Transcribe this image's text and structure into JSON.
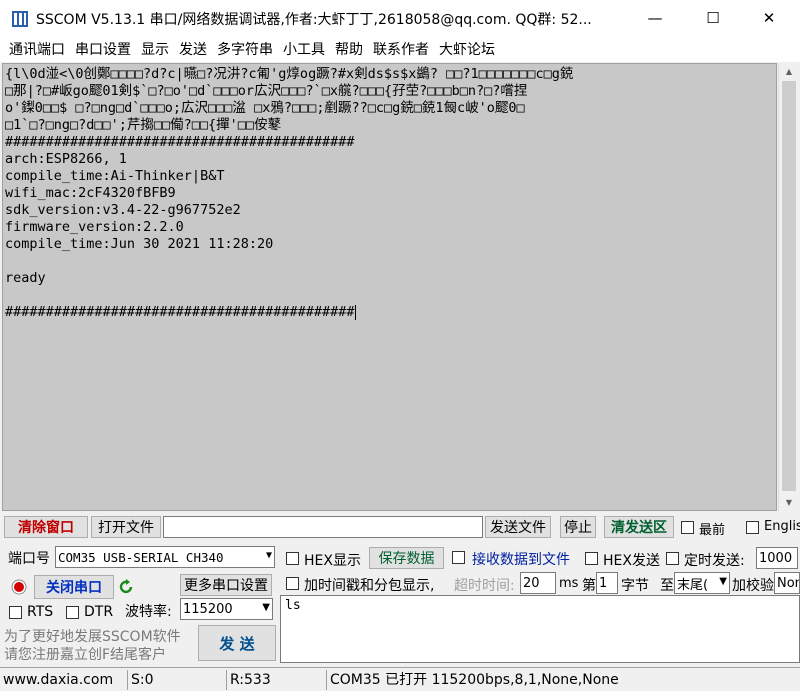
{
  "window": {
    "title": "SSCOM V5.13.1 串口/网络数据调试器,作者:大虾丁丁,2618058@qq.com. QQ群: 52...",
    "minimize": "—",
    "maximize": "☐",
    "close": "✕"
  },
  "menu": [
    "通讯端口",
    "串口设置",
    "显示",
    "发送",
    "多字符串",
    "小工具",
    "帮助",
    "联系作者",
    "大虾论坛"
  ],
  "terminal": {
    "lines": [
      "{l\\0d湴<\\0创鄭□□□□?d?c|曣□?况汫?c匍'g焞og蹶?#x剣ds$s$x鷁? □□?1□□□□□□□c□g鋴",
      "□那|?□#岅go飂01剣$`□?□o'□d`□□□or広沢□□□?`□x艞?□□□{孖茔?□□□b□n?□?嚐捏",
      "o'鏫0□□$ □?□ng□d`□□□o;広沢□□□湓 □x鴉?□□□;剷蹶??□c□g鋴□鋴1匓c岥'o飂0□",
      "□1`□?□ng□?d□□';芹搊□□僃?□□{撣'□□侒鼕",
      "###########################################",
      "arch:ESP8266, 1",
      "compile_time:Ai-Thinker|B&T",
      "wifi_mac:2cF4320fBFB9",
      "sdk_version:v3.4-22-g967752e2",
      "firmware_version:2.2.0",
      "compile_time:Jun 30 2021 11:28:20",
      "",
      "ready",
      "",
      "###########################################"
    ]
  },
  "controls": {
    "clear_window": "清除窗口",
    "open_file": "打开文件",
    "file_path": "",
    "send_file": "发送文件",
    "stop": "停止",
    "clear_send": "清发送区",
    "frontmost": "最前",
    "english": "English",
    "port_label": "端口号",
    "port_value": "COM35 USB-SERIAL CH340",
    "hex_display": "HEX显示",
    "save_data": "保存数据",
    "recv_to_file": "接收数据到文件",
    "hex_send": "HEX发送",
    "timed_send": "定时发送:",
    "timed_interval": "1000",
    "close_port": "关闭串口",
    "more_settings": "更多串口设置",
    "timestamp_split": "加时间戳和分包显示,",
    "timeout_label": "超时时间:",
    "timeout_value": "20",
    "ms": "ms",
    "byte_index_label": "第",
    "byte_index": "1",
    "byte_label": "字节",
    "to_label": "至",
    "end_value": "末尾(",
    "checksum": "加校验",
    "checksum_value": "None",
    "rts": "RTS",
    "dtr": "DTR",
    "baud_label": "波特率:",
    "baud_value": "115200",
    "send_text": "ls",
    "promo_line1": "为了更好地发展SSCOM软件",
    "promo_line2": "请您注册嘉立创F结尾客户",
    "send_button": "发  送"
  },
  "status": {
    "website": "www.daxia.com",
    "sent": "S:0",
    "received": "R:533",
    "port_status": "COM35 已打开  115200bps,8,1,None,None"
  }
}
